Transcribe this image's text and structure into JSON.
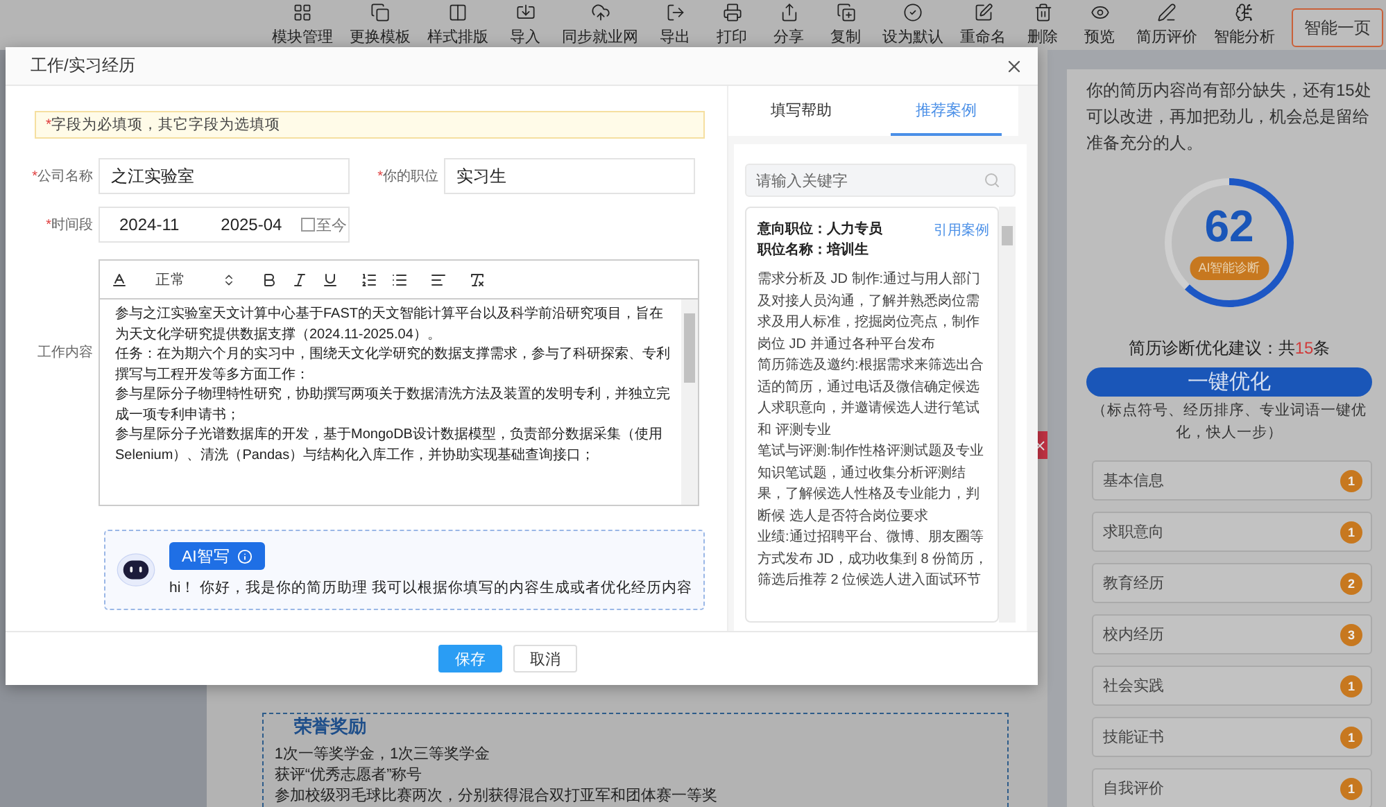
{
  "toolbar": {
    "items": [
      {
        "label": "模块管理"
      },
      {
        "label": "更换模板"
      },
      {
        "label": "样式排版"
      },
      {
        "label": "导入"
      },
      {
        "label": "同步就业网"
      },
      {
        "label": "导出"
      },
      {
        "label": "打印"
      },
      {
        "label": "分享"
      },
      {
        "label": "复制"
      },
      {
        "label": "设为默认"
      },
      {
        "label": "重命名"
      },
      {
        "label": "删除"
      },
      {
        "label": "预览"
      },
      {
        "label": "简历评价"
      },
      {
        "label": "智能分析"
      }
    ],
    "primary_button": "智能一页"
  },
  "resume": {
    "section": {
      "title": "荣誉奖励",
      "lines": [
        "1次一等奖学金，1次三等奖学金",
        "获评“优秀志愿者”称号",
        "参加校级羽毛球比赛两次，分别获得混合双打亚军和团体赛一等奖"
      ]
    }
  },
  "diagnosis": {
    "summary": "你的简历内容尚有部分缺失，还有15处可以改进，再加把劲儿，机会总是留给准备充分的人。",
    "gauge": {
      "score": "62",
      "level": 0.62,
      "badge": "AI智能诊断"
    },
    "suggestion": {
      "prefix": "简历诊断优化建议：共",
      "count": "15",
      "suffix": "条"
    },
    "optimize_button": "一键优化",
    "optimize_note": "（标点符号、经历排序、专业词语一键优化，快人一步）",
    "sections": [
      {
        "label": "基本信息",
        "count": "1"
      },
      {
        "label": "求职意向",
        "count": "1"
      },
      {
        "label": "教育经历",
        "count": "2"
      },
      {
        "label": "校内经历",
        "count": "3"
      },
      {
        "label": "社会实践",
        "count": "1"
      },
      {
        "label": "技能证书",
        "count": "1"
      },
      {
        "label": "自我评价",
        "count": "1"
      }
    ]
  },
  "dialog": {
    "title": "工作/实习经历",
    "notice": {
      "mark": "*",
      "text": "字段为必填项，其它字段为选填项"
    },
    "fields": [
      {
        "mark": "*",
        "label": "公司名称",
        "value": "之江实验室"
      },
      {
        "mark": "*",
        "label": "你的职位",
        "value": "实习生"
      }
    ],
    "period": {
      "mark": "*",
      "label": "时间段",
      "start": "2024-11",
      "end": "2025-04",
      "until_now": {
        "label": "至今",
        "checked": false
      }
    },
    "content": {
      "label": "工作内容",
      "format": "正常",
      "paragraphs": [
        "参与之江实验室天文计算中心基于FAST的天文智能计算平台以及科学前沿研究项目，旨在为天文化学研究提供数据支撑（2024.11-2025.04）。",
        "任务：在为期六个月的实习中，围绕天文化学研究的数据支撑需求，参与了科研探索、专利撰写与工程开发等多方面工作：",
        "参与星际分子物理特性研究，协助撰写两项关于数据清洗方法及装置的发明专利，并独立完成一项专利申请书；",
        "参与星际分子光谱数据库的开发，基于MongoDB设计数据模型，负责部分数据采集（使用Selenium）、清洗（Pandas）与结构化入库工作，并协助实现基础查询接口；"
      ]
    },
    "assistant": {
      "button": "AI智写",
      "greeting": "hi！ 你好，我是你的简历助理 我可以根据你填写的内容生成或者优化经历内容"
    },
    "help": {
      "tabs": [
        {
          "label": "填写帮助",
          "selected": false
        },
        {
          "label": "推荐案例",
          "selected": true
        }
      ],
      "search": {
        "placeholder": "请输入关键字"
      },
      "case": {
        "headings": [
          "意向职位：人力专员",
          "职位名称：培训生"
        ],
        "link": "引用案例",
        "paragraphs": [
          "需求分析及 JD 制作:通过与用人部门及对接人员沟通，了解并熟悉岗位需求及用人标准，挖掘岗位亮点，制作岗位 JD 并通过各种平台发布",
          "简历筛选及邀约:根据需求来筛选出合适的简历，通过电话及微信确定候选人求职意向，并邀请候选人进行笔试和 评测专业",
          "笔试与评测:制作性格评测试题及专业知识笔试题，通过收集分析评测结果，了解候选人性格及专业能力，判断候 选人是否符合岗位要求",
          "业绩:通过招聘平台、微博、朋友圈等方式发布 JD，成功收集到 8 份简历，筛选后推荐 2 位候选人进入面试环节"
        ]
      }
    },
    "buttons": [
      {
        "label": "保存",
        "kind": "primary"
      },
      {
        "label": "取消",
        "kind": "default"
      }
    ]
  }
}
